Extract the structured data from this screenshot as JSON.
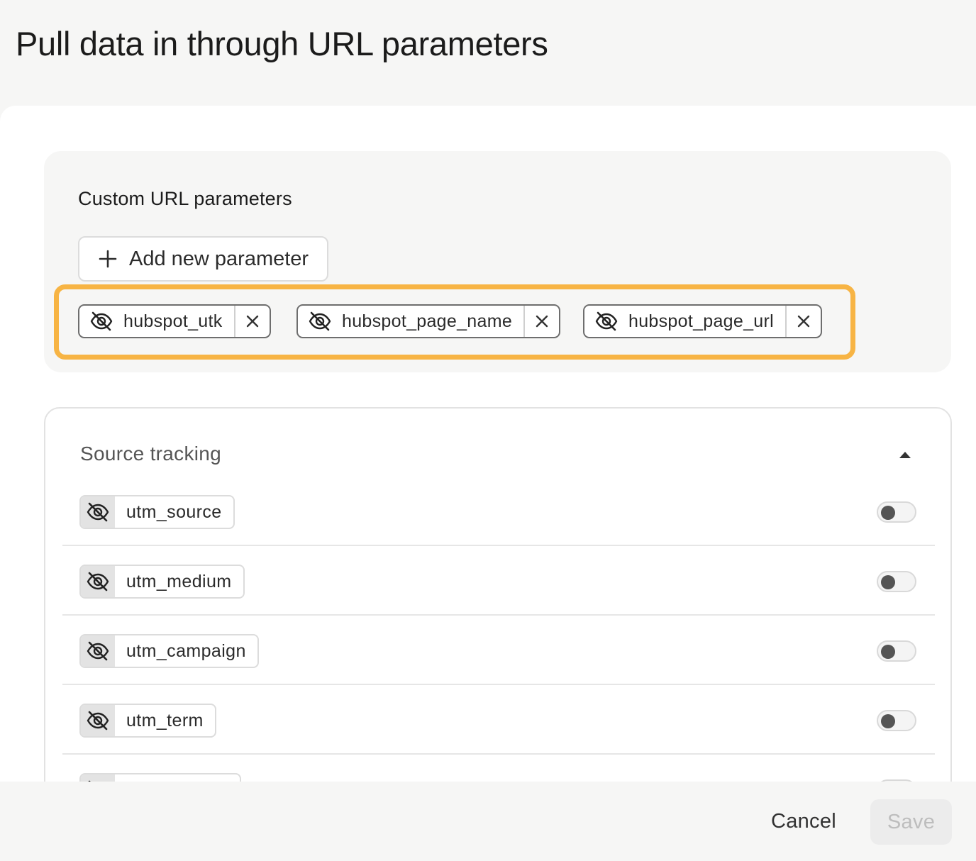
{
  "page": {
    "title": "Pull data in through URL parameters"
  },
  "custom_params": {
    "heading": "Custom URL parameters",
    "add_button_label": "Add new parameter",
    "chips": [
      {
        "label": "hubspot_utk",
        "icon": "eye-off-icon"
      },
      {
        "label": "hubspot_page_name",
        "icon": "eye-off-icon"
      },
      {
        "label": "hubspot_page_url",
        "icon": "eye-off-icon"
      }
    ],
    "highlight_color": "#f7b444"
  },
  "source_tracking": {
    "heading": "Source tracking",
    "rows": [
      {
        "label": "utm_source",
        "enabled": false
      },
      {
        "label": "utm_medium",
        "enabled": false
      },
      {
        "label": "utm_campaign",
        "enabled": false
      },
      {
        "label": "utm_term",
        "enabled": false
      }
    ]
  },
  "footer": {
    "cancel_label": "Cancel",
    "save_label": "Save"
  }
}
